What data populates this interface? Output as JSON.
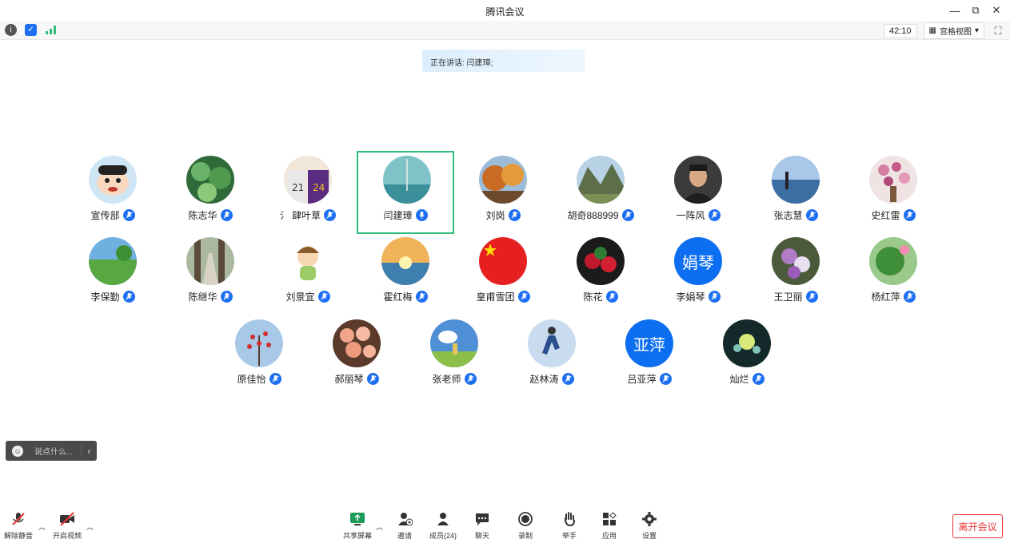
{
  "window": {
    "title": "腾讯会议"
  },
  "top_toolbar": {
    "timer": "42:10",
    "view_label": "宫格视图"
  },
  "speaking_banner": "正在讲话: 闫建璋;",
  "participants_row1": [
    {
      "name": "宣传部",
      "avatar": "cartoon-boy"
    },
    {
      "name": "陈志华",
      "avatar": "green-leaves"
    },
    {
      "name": "氵 肆叶草",
      "avatar": "basketball-jerseys"
    },
    {
      "name": "闫建璋",
      "avatar": "sailboat-sky"
    },
    {
      "name": "刘岗",
      "avatar": "autumn-trees"
    },
    {
      "name": "胡奇888999",
      "avatar": "mountains"
    },
    {
      "name": "一阵风",
      "avatar": "man-portrait"
    },
    {
      "name": "张志慧",
      "avatar": "person-on-lake"
    },
    {
      "name": "史红雷",
      "avatar": "pink-flowers"
    }
  ],
  "participants_row2": [
    {
      "name": "李保勤",
      "avatar": "green-field"
    },
    {
      "name": "陈继华",
      "avatar": "tree-path"
    },
    {
      "name": "刘景宜",
      "avatar": "cartoon-girl"
    },
    {
      "name": "霍红梅",
      "avatar": "sunset-sea"
    },
    {
      "name": "皇甫雪团",
      "avatar": "china-flag"
    },
    {
      "name": "陈花",
      "avatar": "strawberries"
    },
    {
      "name": "李娟琴",
      "avatar_text": "娟琴"
    },
    {
      "name": "王卫丽",
      "avatar": "purple-flowers"
    },
    {
      "name": "杨红萍",
      "avatar": "lotus-leaf"
    }
  ],
  "participants_row3": [
    {
      "name": "原佳怡",
      "avatar": "red-blossom-tree"
    },
    {
      "name": "郝丽琴",
      "avatar": "roses"
    },
    {
      "name": "张老师",
      "avatar": "field-sky"
    },
    {
      "name": "赵林涛",
      "avatar": "running-man"
    },
    {
      "name": "吕亚萍",
      "avatar_text": "亚萍"
    },
    {
      "name": "灿烂",
      "avatar": "dark-flowers"
    }
  ],
  "chat": {
    "placeholder": "说点什么..."
  },
  "bottom_toolbar": {
    "unmute": "解除静音",
    "start_video": "开启视频",
    "share_screen": "共享屏幕",
    "invite": "邀请",
    "members": "成员(24)",
    "chat": "聊天",
    "record": "录制",
    "raise_hand": "举手",
    "apps": "应用",
    "settings": "设置",
    "leave": "离开会议"
  },
  "colors": {
    "active_border": "#2ebd7d",
    "mic_blue": "#1d6ff2",
    "leave_red": "#e33333"
  }
}
